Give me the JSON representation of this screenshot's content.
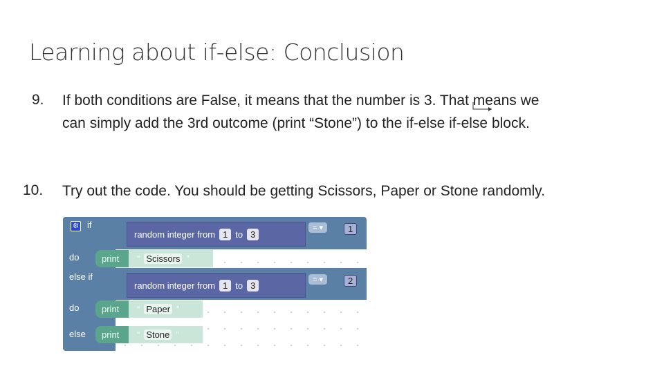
{
  "title": "Learning about if-else: Conclusion",
  "items": [
    {
      "number": "9.",
      "lines": [
        "If both conditions are False, it means that the number is 3. That means we",
        "can simply add the 3rd outcome (print “Stone”) to the if-else if-else block."
      ]
    },
    {
      "number": "10.",
      "lines": [
        "Try out the code. You should be getting Scissors, Paper or Stone randomly."
      ]
    }
  ],
  "blocks": {
    "if_label": "if",
    "do_label": "do",
    "else_if_label": "else if",
    "else_label": "else",
    "random_label": "random integer from",
    "to_label": "to",
    "from_value": "1",
    "to_value": "3",
    "op": "= ▾",
    "compare_1": "1",
    "compare_2": "2",
    "print_label": "print",
    "open_quote": "“",
    "close_quote": "”",
    "outputs": [
      "Scissors",
      "Paper",
      "Stone"
    ]
  },
  "colors": {
    "logic": "#5b80a5",
    "math": "#5b67a5",
    "text": "#5ba58c"
  }
}
